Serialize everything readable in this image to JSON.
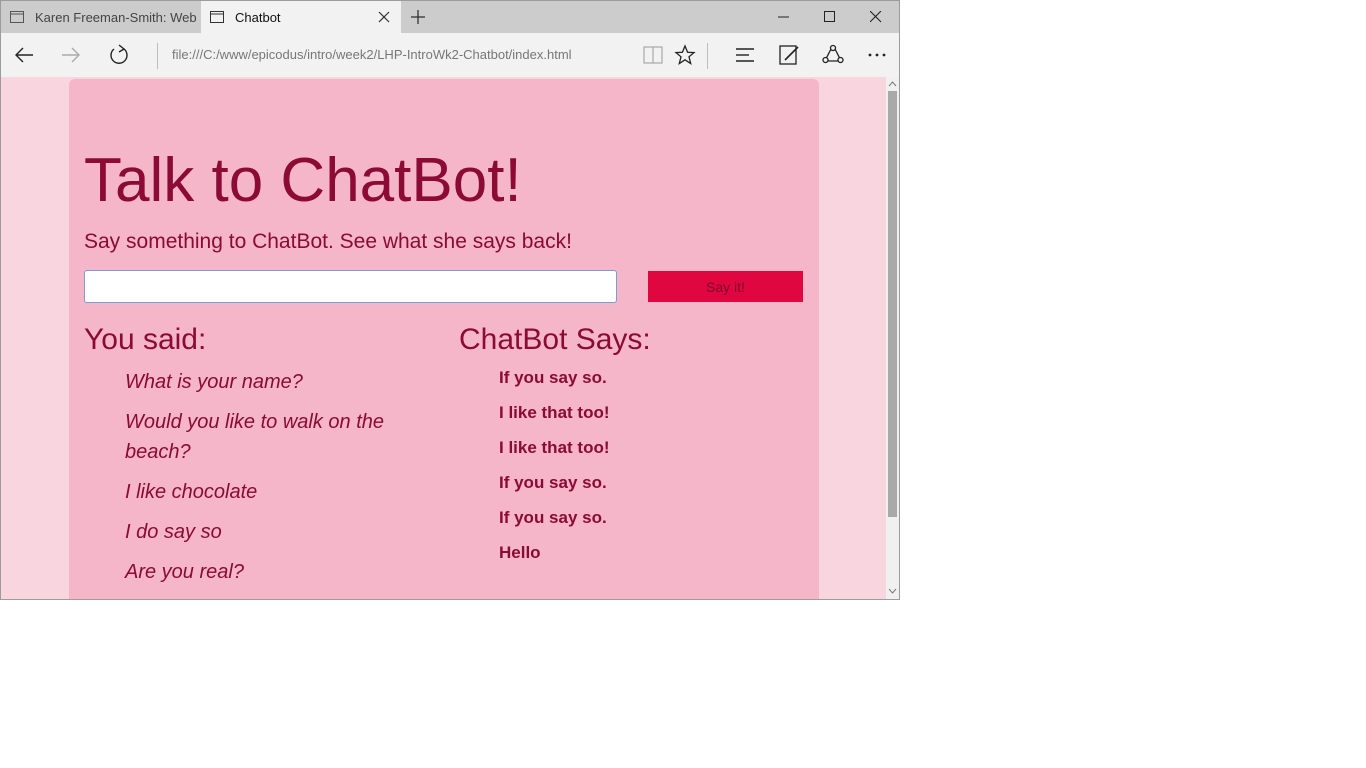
{
  "browser": {
    "tabs": [
      {
        "label": "Karen Freeman-Smith: Web"
      },
      {
        "label": "Chatbot"
      }
    ],
    "address": "file:///C:/www/epicodus/intro/week2/LHP-IntroWk2-Chatbot/index.html"
  },
  "page": {
    "title": "Talk to ChatBot!",
    "subtitle": "Say something to ChatBot. See what she says back!",
    "input_value": "",
    "button_label": "Say it!",
    "you_heading": "You said:",
    "bot_heading": "ChatBot Says:",
    "you_said": [
      "What is your name?",
      "Would you like to walk on the beach?",
      "I like chocolate",
      "I do say so",
      "Are you real?"
    ],
    "bot_says": [
      "If you say so.",
      "I like that too!",
      "I like that too!",
      "If you say so.",
      "If you say so.",
      "Hello"
    ]
  },
  "colors": {
    "page_bg": "#f9d5e0",
    "container_bg": "#f5b6ca",
    "text": "#8b0a36",
    "button": "#e0063f"
  }
}
